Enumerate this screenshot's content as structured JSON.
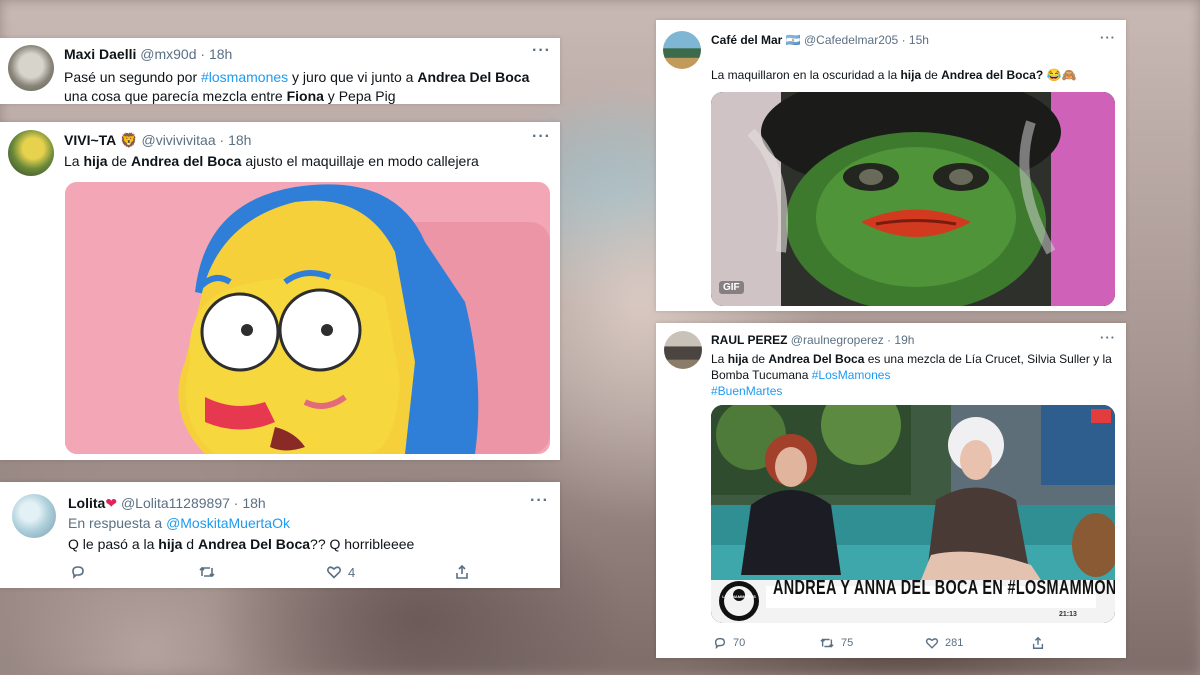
{
  "tweet1": {
    "name": "Maxi Daelli",
    "handle": "@mx90d",
    "time": "18h",
    "text": [
      "Pasé un segundo por ",
      "#losmamones",
      " y juro que vi junto a ",
      "Andrea Del Boca",
      "una cosa que parecía mezcla entre ",
      "Fiona",
      " y Pepa Pig"
    ]
  },
  "tweet2": {
    "name": "VIVI~TA",
    "emoji": "🦁",
    "handle": "@vivivivitaa",
    "time": "18h",
    "text": [
      "La ",
      "hija",
      " de ",
      "Andrea del Boca",
      " ajusto el maquillaje en modo callejera"
    ]
  },
  "tweet3": {
    "name": "Lolita",
    "emoji": "❤",
    "handle": "@Lolita11289897",
    "time": "18h",
    "reply_prefix": "En respuesta a ",
    "reply_to": "@MoskitaMuertaOk",
    "text": [
      "Q le pasó a la ",
      "hija",
      " d ",
      "Andrea Del Boca",
      "?? Q horribleeee"
    ],
    "likes": "4"
  },
  "tweet4": {
    "name": "Café del Mar",
    "flag": "🇦🇷",
    "handle": "@Cafedelmar205",
    "time": "15h",
    "text": [
      "La maquillaron en la oscuridad a la ",
      "hija",
      " de ",
      "Andrea del Boca?",
      " 😂🙈"
    ],
    "gif_label": "GIF"
  },
  "tweet5": {
    "name": "RAUL PEREZ",
    "handle": "@raulnegroperez",
    "time": "19h",
    "text": [
      "La ",
      "hija",
      " de ",
      "Andrea Del Boca",
      " es una mezcla de Lía Crucet, Silvia Suller y la",
      "Bomba Tucumana ",
      "#LosMamones",
      "#BuenMartes"
    ],
    "banner": "ANDREA Y ANNA DEL BOCA EN #LOSMAMMONES",
    "show_logo": "LOS MAMMONES",
    "clock": "21:13",
    "replies": "70",
    "retweets": "75",
    "likes": "281"
  },
  "colors": {
    "link": "#1d9bf0",
    "text": "#0f1419",
    "muted": "#5b7083"
  }
}
